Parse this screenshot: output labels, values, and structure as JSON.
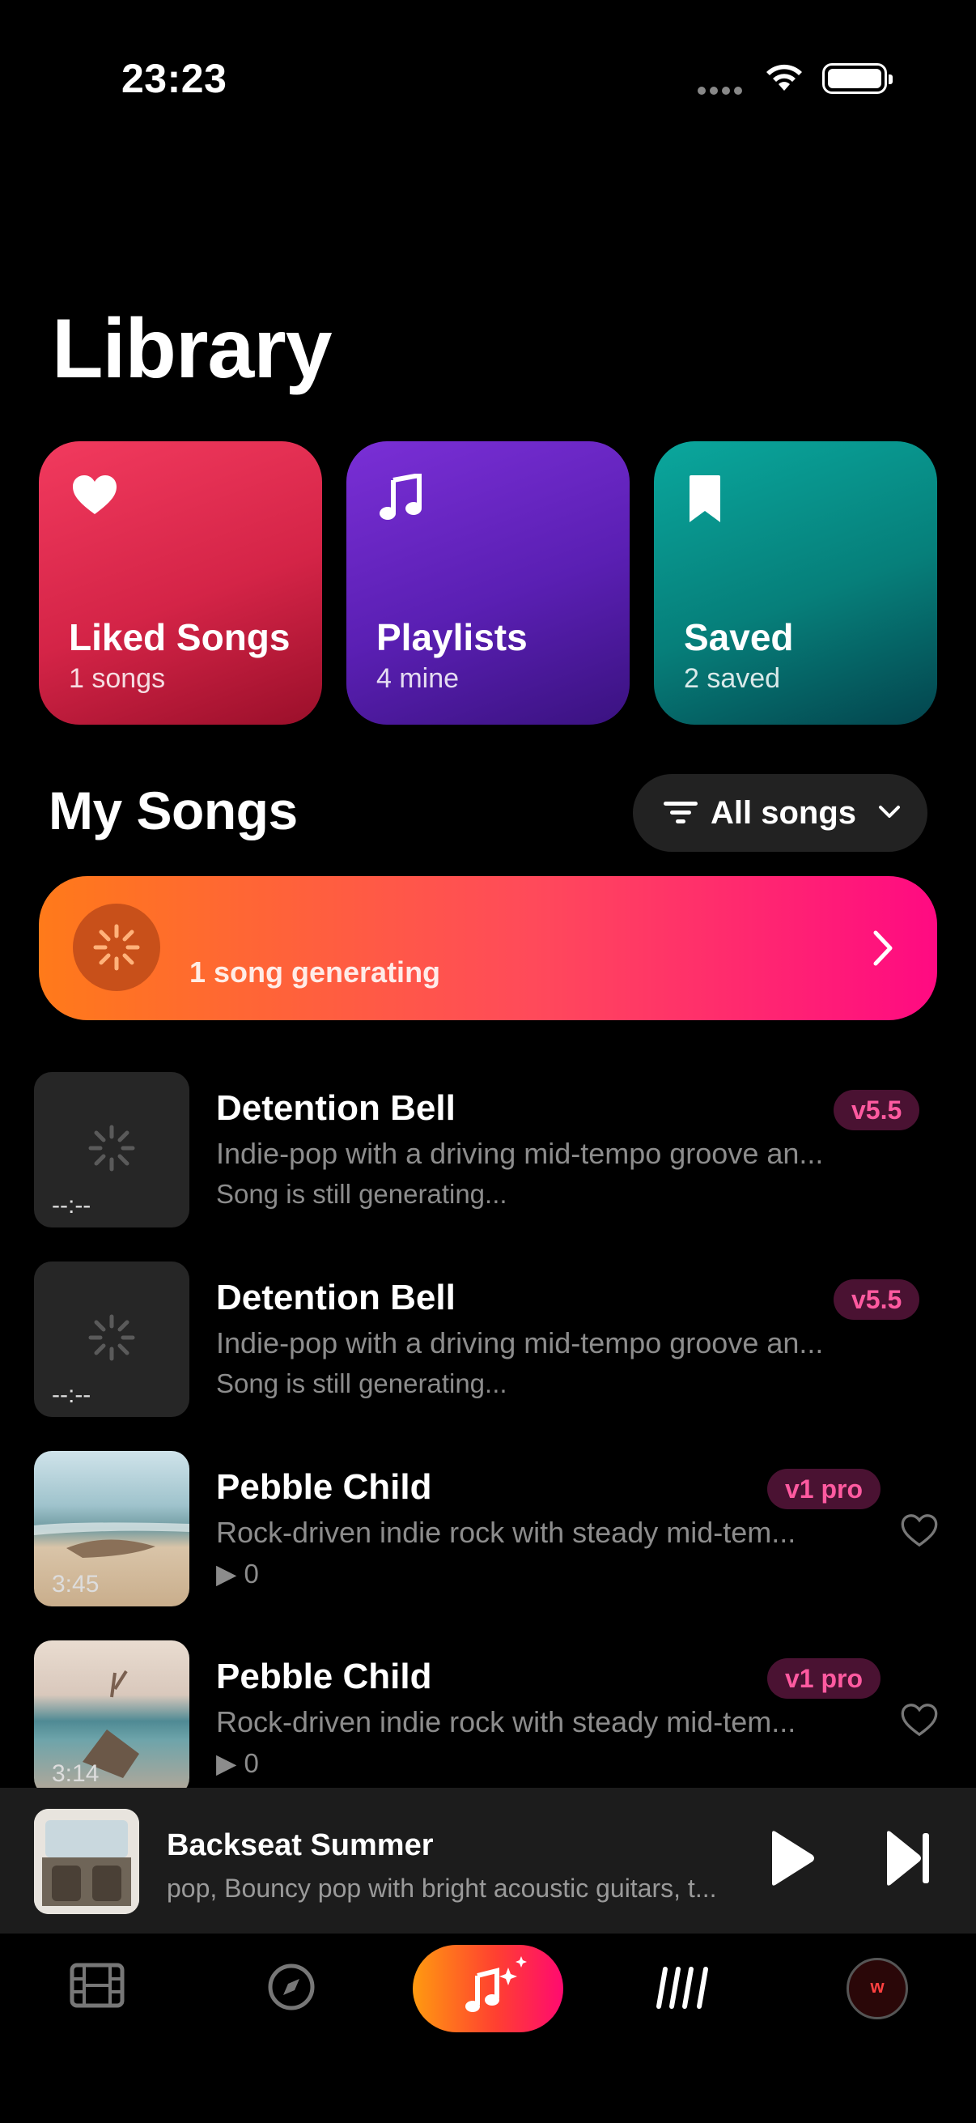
{
  "status_bar": {
    "time": "23:23"
  },
  "page": {
    "title": "Library"
  },
  "collections": [
    {
      "title": "Liked Songs",
      "subtitle": "1 songs",
      "icon": "heart-icon",
      "color": "#e02a4f"
    },
    {
      "title": "Playlists",
      "subtitle": "4 mine",
      "icon": "music-note-icon",
      "color": "#6a25c8"
    },
    {
      "title": "Saved",
      "subtitle": "2 saved",
      "icon": "bookmark-icon",
      "color": "#078d87"
    }
  ],
  "my_songs": {
    "title": "My Songs",
    "filter_label": "All songs",
    "generating_banner": "1 song generating"
  },
  "songs": [
    {
      "title": "Detention Bell",
      "version": "v5.5",
      "description": "Indie-pop with a driving mid-tempo groove an...",
      "status": "Song is still generating...",
      "duration": "--:--"
    },
    {
      "title": "Detention Bell",
      "version": "v5.5",
      "description": "Indie-pop with a driving mid-tempo groove an...",
      "status": "Song is still generating...",
      "duration": "--:--"
    },
    {
      "title": "Pebble Child",
      "version": "v1 pro",
      "description": "Rock-driven indie rock with steady mid-tem...",
      "plays": "▶ 0",
      "duration": "3:45"
    },
    {
      "title": "Pebble Child",
      "version": "v1 pro",
      "description": "Rock-driven indie rock with steady mid-tem...",
      "plays": "▶ 0",
      "duration": "3:14"
    }
  ],
  "now_playing": {
    "title": "Backseat Summer",
    "subtitle": "pop, Bouncy pop with bright acoustic guitars, t..."
  },
  "tab_bar": {
    "avatar_initial": "w",
    "tabs": [
      "film-icon",
      "compass-icon",
      "create-music-icon",
      "library-icon",
      "profile-avatar"
    ]
  },
  "colors": {
    "accent_pink": "#ff5aa0",
    "badge_bg": "#4a1232",
    "background": "#000000"
  }
}
